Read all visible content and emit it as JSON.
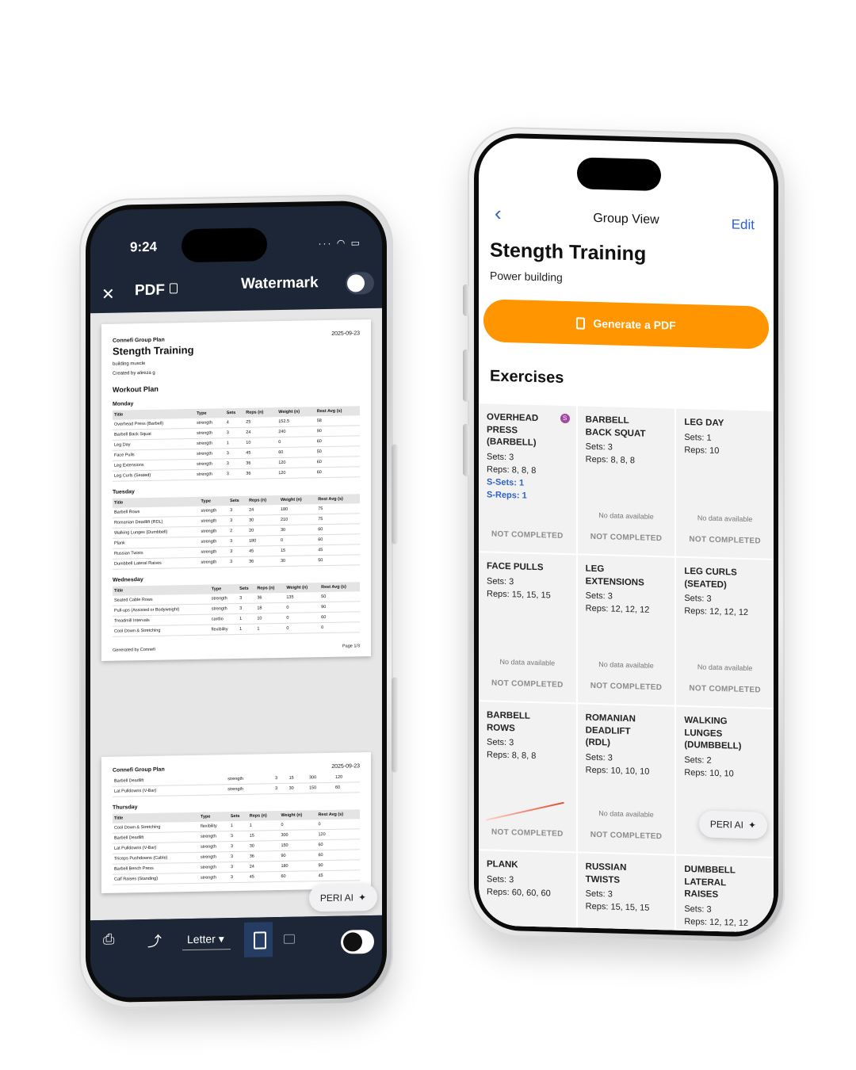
{
  "left_phone": {
    "status": {
      "time": "9:24",
      "signal": "···"
    },
    "header": {
      "close": "✕",
      "title": "PDF",
      "watermark_label": "Watermark"
    },
    "pdf": {
      "page1": {
        "org": "Connefi Group Plan",
        "date": "2025-09-23",
        "title": "Stength Training",
        "subtitle": "building muscle",
        "created_by": "Created by alireza g",
        "section": "Workout Plan",
        "columns": [
          "Title",
          "Type",
          "Sets",
          "Reps (n)",
          "Weight (n)",
          "Rest Avg (s)"
        ],
        "days": [
          {
            "day": "Monday",
            "rows": [
              [
                "Overhead Press (Barbell)",
                "strength",
                "4",
                "25",
                "152.5",
                "58"
              ],
              [
                "Barbell Back Squat",
                "strength",
                "3",
                "24",
                "240",
                "90"
              ],
              [
                "Leg Day",
                "strength",
                "1",
                "10",
                "0",
                "60"
              ],
              [
                "Face Pulls",
                "strength",
                "3",
                "45",
                "60",
                "50"
              ],
              [
                "Leg Extensions",
                "strength",
                "3",
                "36",
                "120",
                "60"
              ],
              [
                "Leg Curls (Seated)",
                "strength",
                "3",
                "36",
                "120",
                "60"
              ]
            ]
          },
          {
            "day": "Tuesday",
            "rows": [
              [
                "Barbell Rows",
                "strength",
                "3",
                "24",
                "180",
                "75"
              ],
              [
                "Romanian Deadlift (RDL)",
                "strength",
                "3",
                "30",
                "210",
                "75"
              ],
              [
                "Walking Lunges (Dumbbell)",
                "strength",
                "2",
                "20",
                "30",
                "60"
              ],
              [
                "Plank",
                "strength",
                "3",
                "180",
                "0",
                "60"
              ],
              [
                "Russian Twists",
                "strength",
                "3",
                "45",
                "15",
                "45"
              ],
              [
                "Dumbbell Lateral Raises",
                "strength",
                "3",
                "36",
                "30",
                "50"
              ]
            ]
          },
          {
            "day": "Wednesday",
            "rows": [
              [
                "Seated Cable Rows",
                "strength",
                "3",
                "36",
                "135",
                "50"
              ],
              [
                "Pull-ups (Assisted or Bodyweight)",
                "strength",
                "3",
                "18",
                "0",
                "90"
              ],
              [
                "Treadmill Intervals",
                "cardio",
                "1",
                "10",
                "0",
                "60"
              ],
              [
                "Cool Down & Stretching",
                "flexibility",
                "1",
                "1",
                "0",
                "0"
              ]
            ]
          }
        ],
        "footer_left": "Generated by Connefi",
        "footer_right": "Page 1/3"
      },
      "page2": {
        "org": "Connefi Group Plan",
        "date": "2025-09-23",
        "top_rows": [
          [
            "Barbell Deadlift",
            "strength",
            "3",
            "15",
            "300",
            "120"
          ],
          [
            "Lat Pulldowns (V-Bar)",
            "strength",
            "3",
            "30",
            "150",
            "60"
          ]
        ],
        "day": "Thursday",
        "rows": [
          [
            "Cool Down & Stretching",
            "flexibility",
            "1",
            "1",
            "0",
            "0"
          ],
          [
            "Barbell Deadlift",
            "strength",
            "3",
            "15",
            "300",
            "120"
          ],
          [
            "Lat Pulldowns (V-Bar)",
            "strength",
            "3",
            "30",
            "150",
            "60"
          ],
          [
            "Triceps Pushdowns (Cable)",
            "strength",
            "3",
            "36",
            "90",
            "60"
          ],
          [
            "Barbell Bench Press",
            "strength",
            "3",
            "24",
            "180",
            "90"
          ],
          [
            "Calf Raises (Standing)",
            "strength",
            "3",
            "45",
            "60",
            "45"
          ]
        ]
      }
    },
    "peri": {
      "label": "PERI AI",
      "icon": "sparkle-icon"
    },
    "toolbar": {
      "paper_size": "Letter"
    }
  },
  "right_phone": {
    "nav": {
      "back": "‹",
      "title": "Group View",
      "edit": "Edit"
    },
    "title": "Stength Training",
    "subtitle": "Power building",
    "generate_button": "Generate a PDF",
    "accent": "#ff9500",
    "exercises_heading": "Exercises",
    "exercises": [
      {
        "name": "Overhead Press (Barbell)",
        "sets": "Sets: 3",
        "reps": "Reps: 8, 8, 8",
        "ssets": "S-Sets: 1",
        "sreps": "S-Reps: 1",
        "nodata": "",
        "status": "NOT COMPLETED",
        "badge": "S"
      },
      {
        "name": "Barbell Back Squat",
        "sets": "Sets: 3",
        "reps": "Reps: 8, 8, 8",
        "nodata": "No data available",
        "status": "NOT COMPLETED"
      },
      {
        "name": "Leg Day",
        "sets": "Sets: 1",
        "reps": "Reps: 10",
        "nodata": "No data available",
        "status": "NOT COMPLETED"
      },
      {
        "name": "Face Pulls",
        "sets": "Sets: 3",
        "reps": "Reps: 15, 15, 15",
        "nodata": "No data available",
        "status": "NOT COMPLETED"
      },
      {
        "name": "Leg Extensions",
        "sets": "Sets: 3",
        "reps": "Reps: 12, 12, 12",
        "nodata": "No data available",
        "status": "NOT COMPLETED"
      },
      {
        "name": "Leg Curls (Seated)",
        "sets": "Sets: 3",
        "reps": "Reps: 12, 12, 12",
        "nodata": "No data available",
        "status": "NOT COMPLETED"
      },
      {
        "name": "Barbell Rows",
        "sets": "Sets: 3",
        "reps": "Reps: 8, 8, 8",
        "nodata": "",
        "status": "NOT COMPLETED"
      },
      {
        "name": "Romanian Deadlift (RDL)",
        "sets": "Sets: 3",
        "reps": "Reps: 10, 10, 10",
        "nodata": "No data available",
        "status": "NOT COMPLETED"
      },
      {
        "name": "Walking Lunges (Dumbbell)",
        "sets": "Sets: 2",
        "reps": "Reps: 10, 10",
        "nodata": "",
        "status": ""
      },
      {
        "name": "Plank",
        "sets": "Sets: 3",
        "reps": "Reps: 60, 60, 60"
      },
      {
        "name": "Russian Twists",
        "sets": "Sets: 3",
        "reps": "Reps: 15, 15, 15"
      },
      {
        "name": "Dumbbell Lateral Raises",
        "sets": "Sets: 3",
        "reps": "Reps: 12, 12, 12"
      }
    ],
    "peri": {
      "label": "PERI AI",
      "icon": "sparkle-icon"
    }
  }
}
